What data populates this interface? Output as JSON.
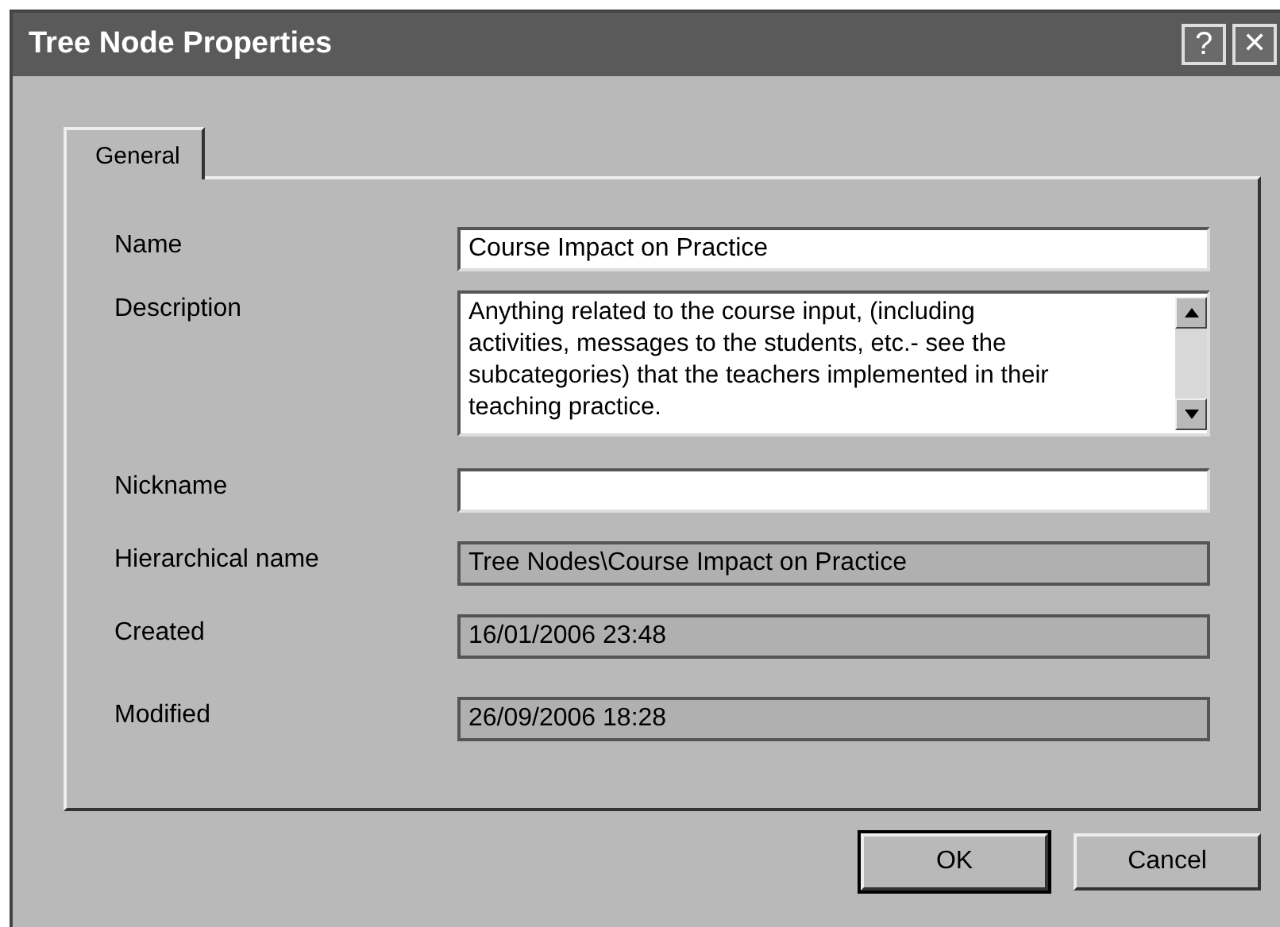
{
  "window": {
    "title": "Tree Node Properties",
    "title_buttons": [
      {
        "kind": "help",
        "label": "?"
      },
      {
        "kind": "close",
        "label": "✕"
      }
    ]
  },
  "tabs": [
    {
      "label": "General",
      "selected": true
    }
  ],
  "fields": [
    {
      "kind": "text",
      "label": "Name",
      "value": "Course Impact on Practice"
    },
    {
      "kind": "textarea",
      "label": "Description",
      "value": "Anything related to the course input, (including activities, messages to the students, etc.- see the subcategories) that the teachers implemented in their teaching practice."
    },
    {
      "kind": "text",
      "label": "Nickname"
    },
    {
      "kind": "readonly",
      "label": "Hierarchical name",
      "value": "Tree Nodes\\Course Impact on Practice"
    },
    {
      "kind": "readonly",
      "label": "Created",
      "value": "16/01/2006 23:48"
    },
    {
      "kind": "readonly",
      "label": "Modified",
      "value": "26/09/2006 18:28"
    }
  ],
  "buttons": [
    {
      "label": "OK",
      "default": true
    },
    {
      "label": "Cancel",
      "default": false
    }
  ]
}
